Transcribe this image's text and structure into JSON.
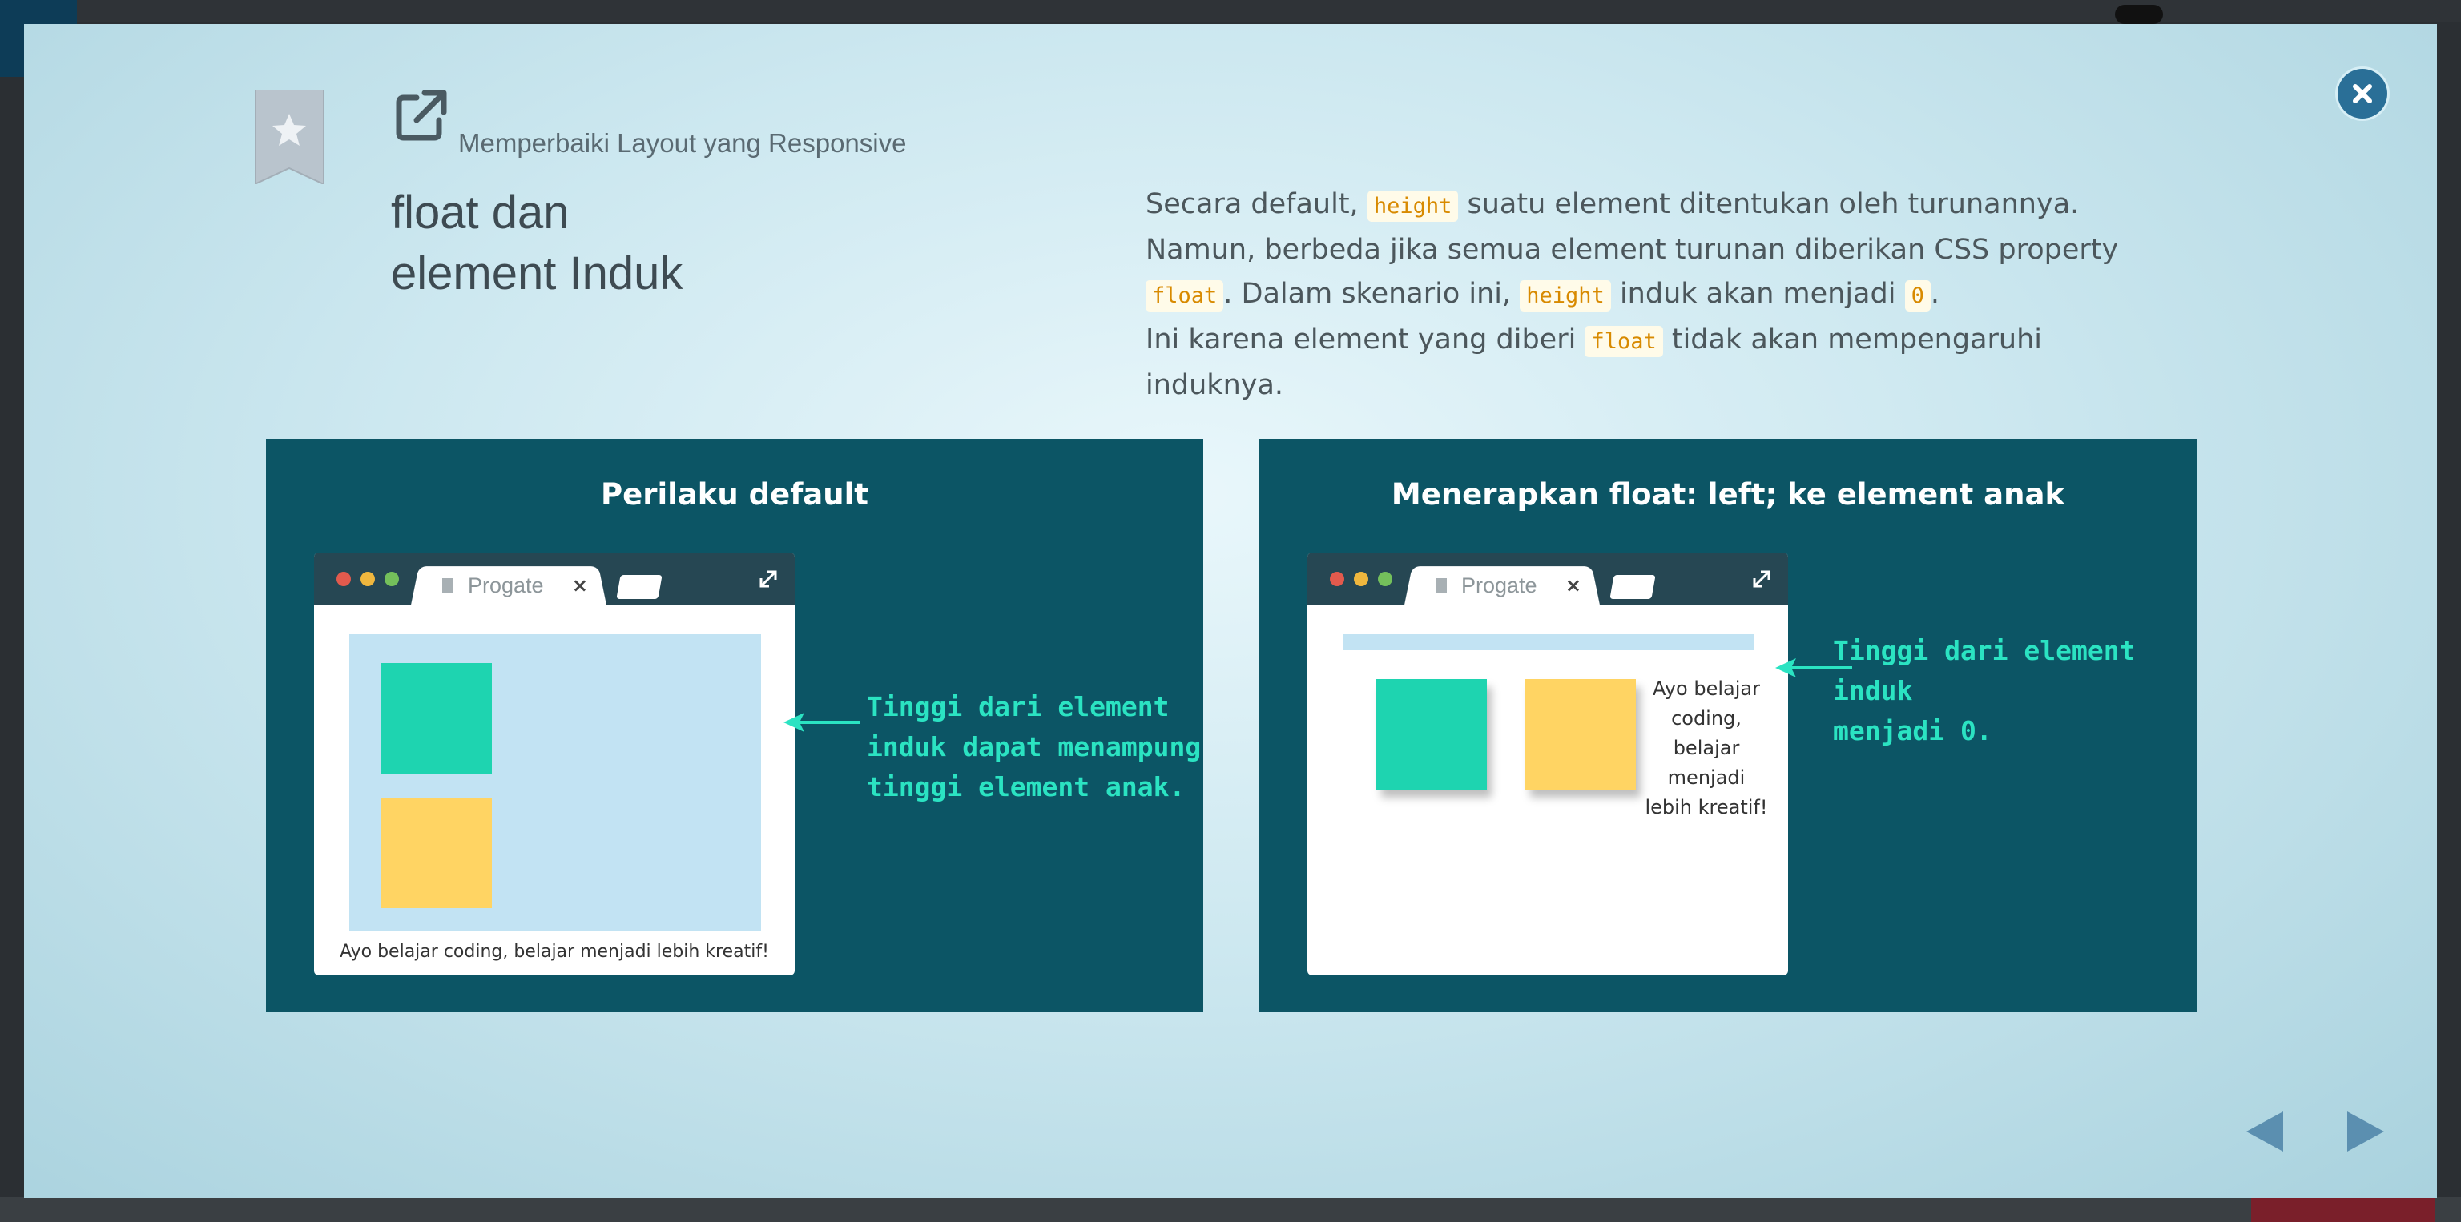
{
  "header": {
    "lesson_title": "Memperbaiki Layout yang Responsive",
    "slide_title_line1": "float dan",
    "slide_title_line2": "element Induk"
  },
  "description": {
    "p1_a": "Secara default, ",
    "p1_code": "height",
    "p1_b": " suatu element ditentukan oleh turunannya.",
    "p2_a": "Namun, berbeda jika semua element turunan diberikan CSS property",
    "p2_code1": "float",
    "p2_b": ". Dalam skenario ini, ",
    "p2_code2": "height",
    "p2_c": " induk akan menjadi ",
    "p2_code3": "0",
    "p2_d": ".",
    "p3_a": "Ini karena element yang diberi ",
    "p3_code": "float",
    "p3_b": " tidak akan mempengaruhi induknya."
  },
  "panels": {
    "left": {
      "heading": "Perilaku default",
      "tab_label": "Progate",
      "tab_close": "×",
      "caption": "Ayo belajar coding, belajar menjadi lebih kreatif!",
      "callout_line1": "Tinggi dari element",
      "callout_line2": "induk dapat menampung",
      "callout_line3": "tinggi element anak."
    },
    "right": {
      "heading": "Menerapkan float: left; ke element anak",
      "tab_label": "Progate",
      "tab_close": "×",
      "float_text": "Ayo belajar coding, belajar menjadi lebih kreatif!",
      "callout_line1": "Tinggi dari element induk",
      "callout_line2": "menjadi 0."
    }
  },
  "colors": {
    "panel_bg": "#0c5565",
    "accent_green": "#1ed4b0",
    "accent_yellow": "#ffd463",
    "callout": "#2be3c2",
    "close_button": "#2a6f97",
    "nav_arrow": "#5b8fb0",
    "code_text": "#d88a00"
  },
  "icons": {
    "bookmark": "bookmark-star-icon",
    "external": "external-link-icon",
    "close": "close-icon",
    "prev": "triangle-left-icon",
    "next": "triangle-right-icon",
    "expand": "expand-icon"
  }
}
